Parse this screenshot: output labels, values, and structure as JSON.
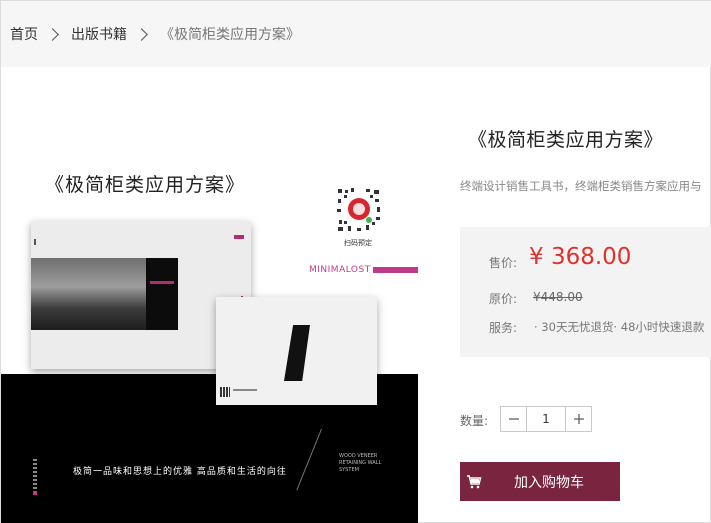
{
  "breadcrumb": {
    "home": "首页",
    "category": "出版书籍",
    "current": "《极简柜类应用方案》"
  },
  "image": {
    "cover_title": "《极简柜类应用方案》",
    "qr_caption": "扫码预定",
    "brand_text": "MINIMALOST",
    "slogan": "极简一品味和思想上的优雅  高品质和生活的向往",
    "side_text": "WOOD VENEER RETAINING WALL SYSTEM",
    "accent_color": "#c03a8a"
  },
  "product": {
    "title": "《极简柜类应用方案》",
    "description": "终端设计销售工具书，终端柜类销售方案应用与",
    "price_label": "售价:",
    "price": "¥ 368.00",
    "original_label": "原价:",
    "original_price": "¥448.00",
    "service_label": "服务:",
    "service_value": "· 30天无忧退货· 48小时快速退款",
    "quantity_label": "数量:",
    "quantity": "1",
    "add_to_cart": "加入购物车",
    "price_color": "#e0312b",
    "button_color": "#7a2540"
  }
}
